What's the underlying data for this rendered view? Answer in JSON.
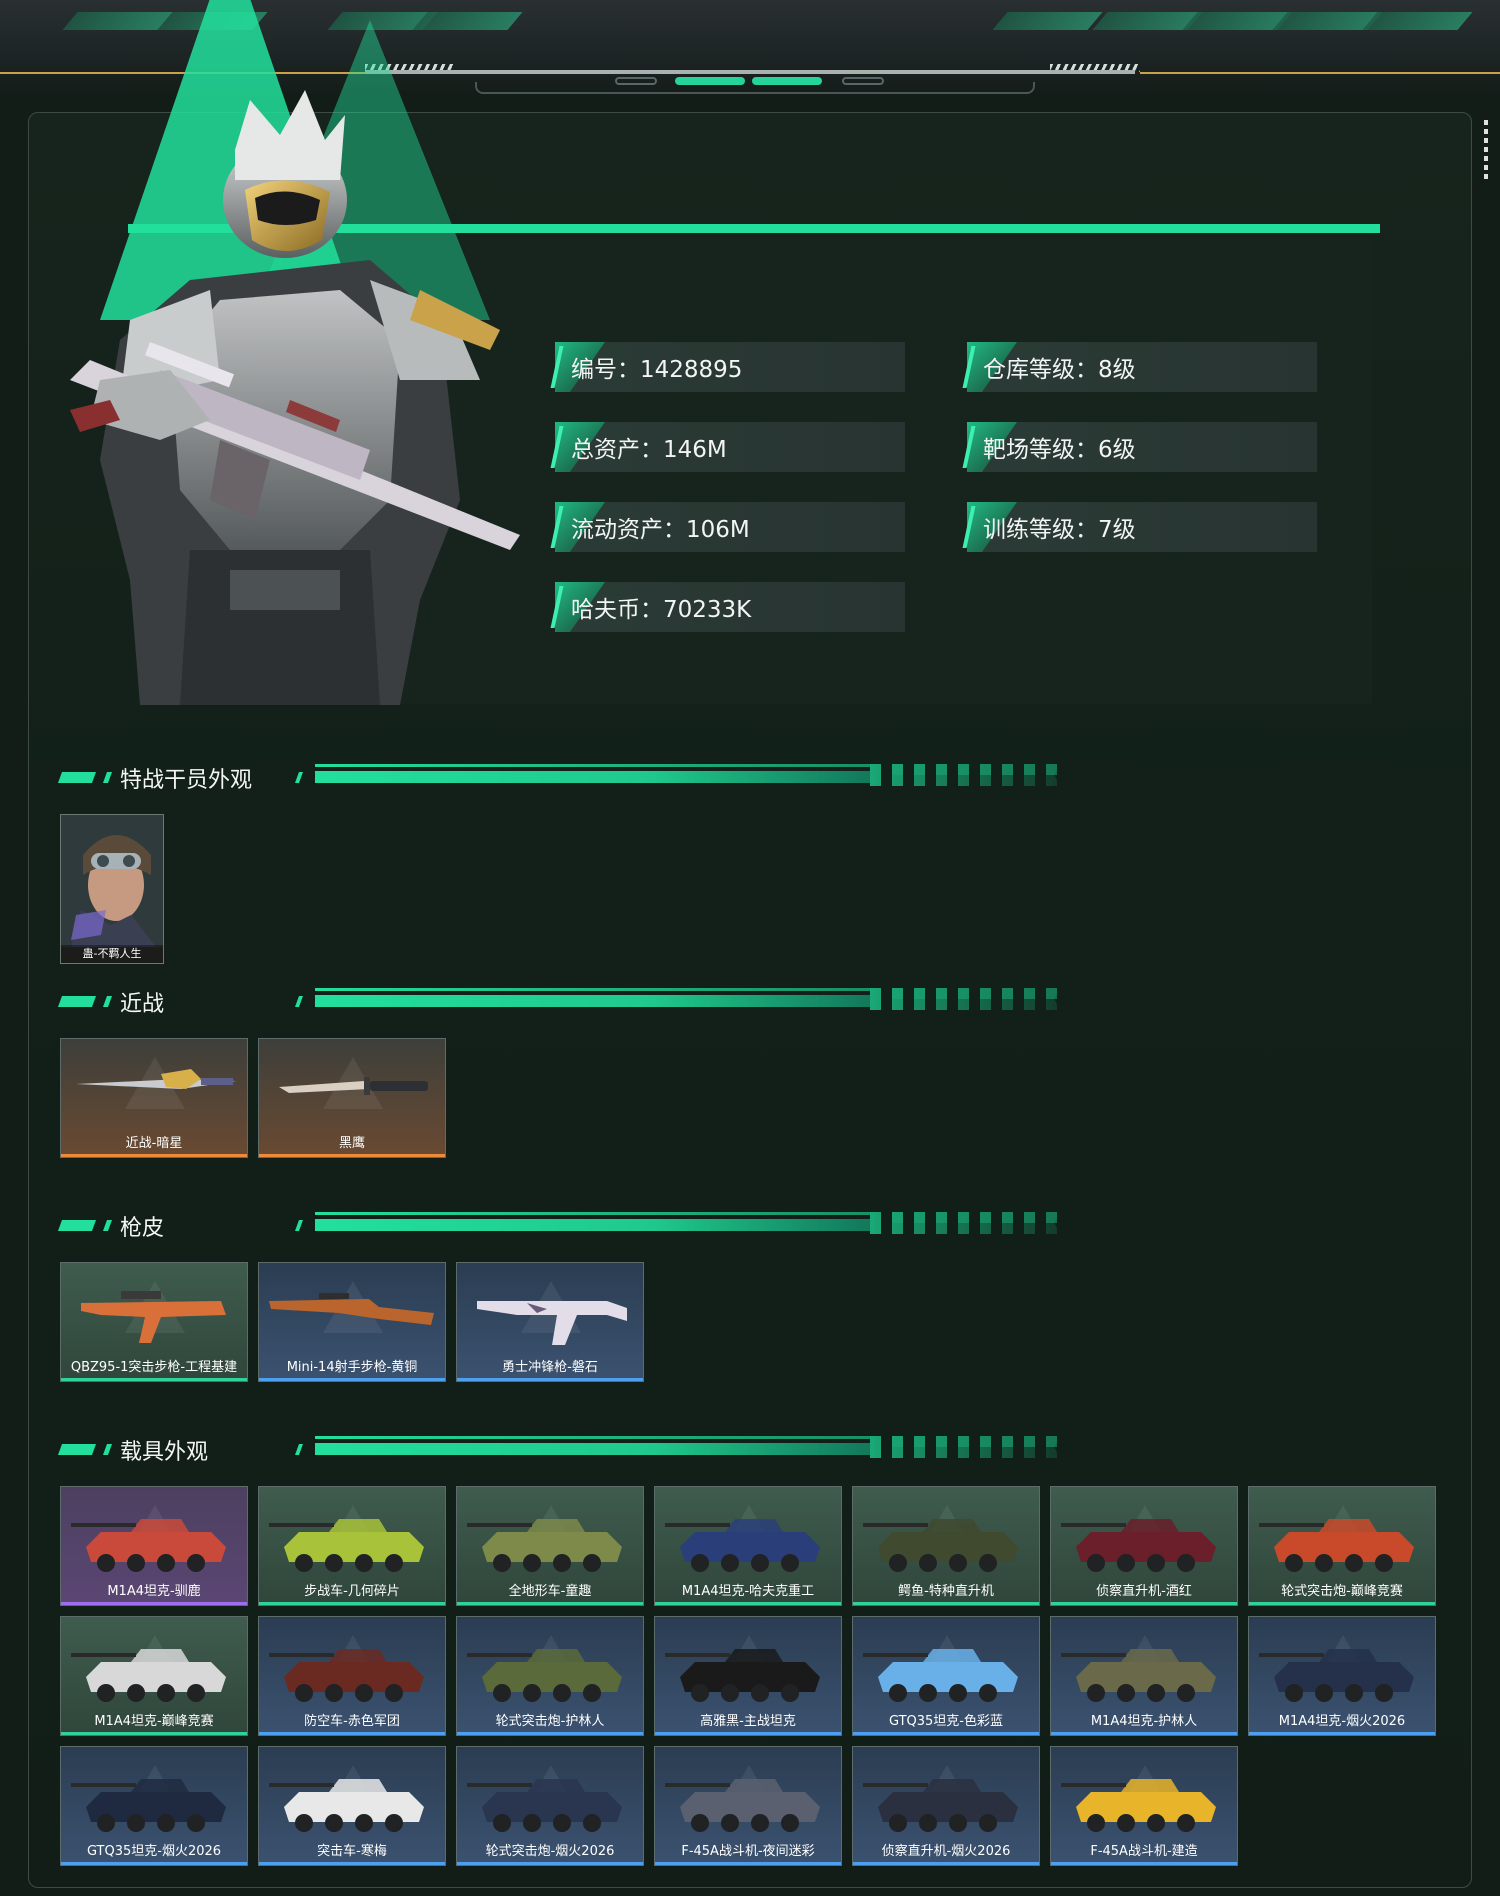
{
  "stats": {
    "id": "编号：1428895",
    "warehouse_level": "仓库等级：8级",
    "total_assets": "总资产：146M",
    "range_level": "靶场等级：6级",
    "liquid_assets": "流动资产：106M",
    "training_level": "训练等级：7级",
    "havoc_coin": "哈夫币：70233K"
  },
  "sections": {
    "agent": "特战干员外观",
    "melee": "近战",
    "gun_skin": "枪皮",
    "vehicle": "载具外观"
  },
  "agent_items": [
    {
      "label": "蛊-不羁人生"
    }
  ],
  "melee_items": [
    {
      "label": "近战-暗星",
      "rarity": "orange"
    },
    {
      "label": "黑鹰",
      "rarity": "orange"
    }
  ],
  "gun_items": [
    {
      "label": "QBZ95-1突击步枪-工程基建",
      "rarity": "green"
    },
    {
      "label": "Mini-14射手步枪-黄铜",
      "rarity": "blue"
    },
    {
      "label": "勇士冲锋枪-磐石",
      "rarity": "blue"
    }
  ],
  "vehicle_items": [
    {
      "label": "M1A4坦克-驯鹿",
      "rarity": "purple"
    },
    {
      "label": "步战车-几何碎片",
      "rarity": "green"
    },
    {
      "label": "全地形车-童趣",
      "rarity": "green"
    },
    {
      "label": "M1A4坦克-哈夫克重工",
      "rarity": "green"
    },
    {
      "label": "鳄鱼-特种直升机",
      "rarity": "green"
    },
    {
      "label": "侦察直升机-酒红",
      "rarity": "green"
    },
    {
      "label": "轮式突击炮-巅峰竞赛",
      "rarity": "green"
    },
    {
      "label": "M1A4坦克-巅峰竞赛",
      "rarity": "green"
    },
    {
      "label": "防空车-赤色军团",
      "rarity": "blue"
    },
    {
      "label": "轮式突击炮-护林人",
      "rarity": "blue"
    },
    {
      "label": "高雅黑-主战坦克",
      "rarity": "blue"
    },
    {
      "label": "GTQ35坦克-色彩蓝",
      "rarity": "blue"
    },
    {
      "label": "M1A4坦克-护林人",
      "rarity": "blue"
    },
    {
      "label": "M1A4坦克-烟火2026",
      "rarity": "blue"
    },
    {
      "label": "GTQ35坦克-烟火2026",
      "rarity": "blue"
    },
    {
      "label": "突击车-寒梅",
      "rarity": "blue"
    },
    {
      "label": "轮式突击炮-烟火2026",
      "rarity": "blue"
    },
    {
      "label": "F-45A战斗机-夜间迷彩",
      "rarity": "blue"
    },
    {
      "label": "侦察直升机-烟火2026",
      "rarity": "blue"
    },
    {
      "label": "F-45A战斗机-建造",
      "rarity": "blue"
    }
  ],
  "colors": {
    "accent": "#22e09c",
    "rarity_green": "#2fd39a",
    "rarity_blue": "#4d9ff0",
    "rarity_purple": "#a06cf0",
    "rarity_orange": "#ee8a3a"
  }
}
